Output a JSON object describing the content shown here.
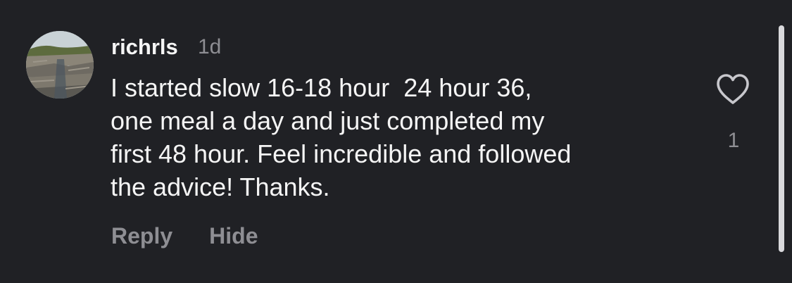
{
  "comment": {
    "username": "richrls",
    "timestamp": "1d",
    "body_lines": [
      "I started slow 16-18 hour  24 hour 36,",
      "one meal a day and just completed my",
      "first 48 hour. Feel incredible and followed",
      "the advice! Thanks."
    ],
    "like_count": "1",
    "reply_label": "Reply",
    "hide_label": "Hide"
  },
  "colors": {
    "background": "#202125",
    "primary_text": "#f5f5f5",
    "secondary_text": "#8e8e93",
    "heart_outline": "#c7c7cc",
    "scrollbar": "#d9d9dc"
  },
  "icons": {
    "like": "heart-outline-icon",
    "avatar": "rocky-landscape-photo"
  }
}
